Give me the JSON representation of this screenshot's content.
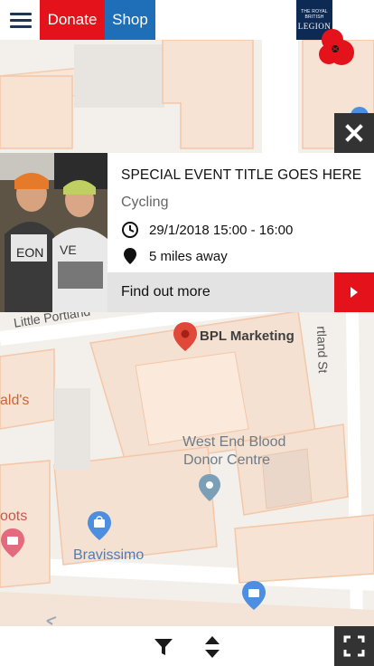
{
  "header": {
    "donate_label": "Donate",
    "shop_label": "Shop",
    "logo_small": "THE ROYAL BRITISH",
    "logo_big": "LEGION"
  },
  "map": {
    "labels": {
      "street_little_portland": "Little Portland",
      "street_portland_st": "rtland St",
      "bpl_marketing": "BPL Marketing",
      "west_end_line1": "West End Blood",
      "west_end_line2": "Donor Centre",
      "bravissimo": "Bravissimo",
      "alds": "ald's",
      "boots": "oots"
    }
  },
  "event": {
    "title": "SPECIAL EVENT TITLE GOES HERE",
    "category": "Cycling",
    "datetime": "29/1/2018 15:00 - 16:00",
    "distance": "5 miles away",
    "cta": "Find out more"
  },
  "icons": {
    "close": "close-icon",
    "clock": "clock-icon",
    "pin": "map-pin-icon",
    "arrow": "chevron-right-icon",
    "filter": "filter-icon",
    "sort": "sort-icon",
    "fullscreen": "fullscreen-icon"
  },
  "colors": {
    "donate": "#e4121b",
    "shop": "#1e6fb8",
    "legion_navy": "#0d2a55",
    "accent_red": "#e4121b",
    "dark_button": "#333333"
  }
}
